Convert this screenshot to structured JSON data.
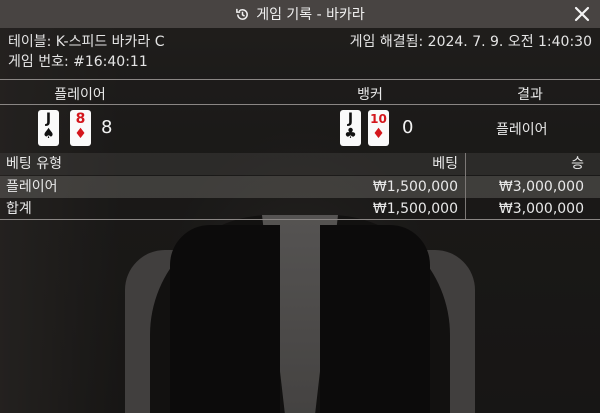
{
  "header": {
    "title": "게임 기록 - 바카라",
    "history_icon": "history-icon",
    "close_icon": "close-icon"
  },
  "info": {
    "table_label": "테이블: K-스피드 바카라 C",
    "game_number_label": "게임 번호: #16:40:11",
    "settled_label": "게임 해결됨: 2024. 7. 9. 오전 1:40:30"
  },
  "result": {
    "player_header": "플레이어",
    "banker_header": "뱅커",
    "outcome_header": "결과",
    "player_cards": [
      {
        "rank": "J",
        "suit": "♠",
        "color": "black"
      },
      {
        "rank": "8",
        "suit": "♦",
        "color": "red"
      }
    ],
    "player_score": "8",
    "banker_cards": [
      {
        "rank": "J",
        "suit": "♣",
        "color": "black"
      },
      {
        "rank": "10",
        "suit": "♦",
        "color": "red"
      }
    ],
    "banker_score": "0",
    "outcome": "플레이어"
  },
  "bets": {
    "columns": [
      "베팅 유형",
      "베팅",
      "승"
    ],
    "rows": [
      {
        "type": "플레이어",
        "bet": "₩1,500,000",
        "win": "₩3,000,000"
      },
      {
        "type": "합계",
        "bet": "₩1,500,000",
        "win": "₩3,000,000"
      }
    ]
  },
  "colors": {
    "header_bg": "#484442",
    "red_suit": "#d4161c",
    "card_bg": "#fafafa"
  }
}
